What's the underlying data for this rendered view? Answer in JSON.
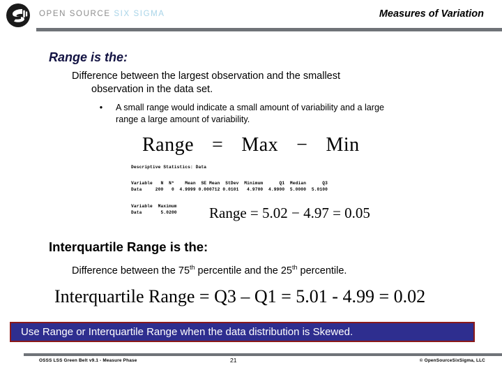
{
  "header": {
    "logo_icon": "opensource-sixsigma-logo-icon",
    "brand_prefix": "OPEN SOURCE ",
    "brand_accent": "SIX SIGMA",
    "title": "Measures of Variation"
  },
  "range_section": {
    "heading": "Range is the:",
    "definition_line1": "Difference between the largest observation and the smallest",
    "definition_line2": "observation in the data set.",
    "bullet_marker": "•",
    "bullet_line1": "A small range would indicate a small amount of variability and a large",
    "bullet_line2": "range a large amount of variability.",
    "equation": {
      "lhs": "Range",
      "eq_sign": "=",
      "max": "Max",
      "minus": "−",
      "min": "Min"
    },
    "calc_equation": "Range = 5.02 − 4.97 = 0.05"
  },
  "minitab": {
    "title": "Descriptive Statistics: Data",
    "table1_header": "Variable   N  N*    Mean  SE Mean  StDev  Minimum      Q1  Median      Q3",
    "table1_row": "Data     200   0  4.9999 0.000712 0.0101   4.9700  4.9900  5.0000  5.0100",
    "table2_header": "Variable  Maximum",
    "table2_row": "Data       5.0200",
    "columns": [
      "Variable",
      "N",
      "N*",
      "Mean",
      "SE Mean",
      "StDev",
      "Minimum",
      "Q1",
      "Median",
      "Q3",
      "Maximum"
    ],
    "values": [
      "Data",
      "200",
      "0",
      "4.9999",
      "0.000712",
      "0.0101",
      "4.9700",
      "4.9900",
      "5.0000",
      "5.0100",
      "5.0200"
    ]
  },
  "iqr_section": {
    "heading": "Interquartile Range is the:",
    "definition_prefix": "Difference between the 75",
    "sup1": "th",
    "definition_mid": " percentile and the 25",
    "sup2": "th",
    "definition_suffix": " percentile.",
    "equation": "Interquartile Range = Q3 – Q1 = 5.01 - 4.99 = 0.02"
  },
  "callout": {
    "text": "Use Range or Interquartile Range when the data distribution is Skewed.",
    "fill_color": "#2e2e8f",
    "border_color": "#8a1a1a",
    "text_color": "#ffffff"
  },
  "footer": {
    "left": "OSSS LSS Green Belt v9.1 - Measure Phase",
    "page_number": "21",
    "right": "© OpenSourceSixSigma, LLC"
  },
  "colors": {
    "heading_navy": "#131343",
    "rule_gray": "#6f7378",
    "brand_gray": "#8d8d8d",
    "brand_accent": "#a8d4e8"
  }
}
